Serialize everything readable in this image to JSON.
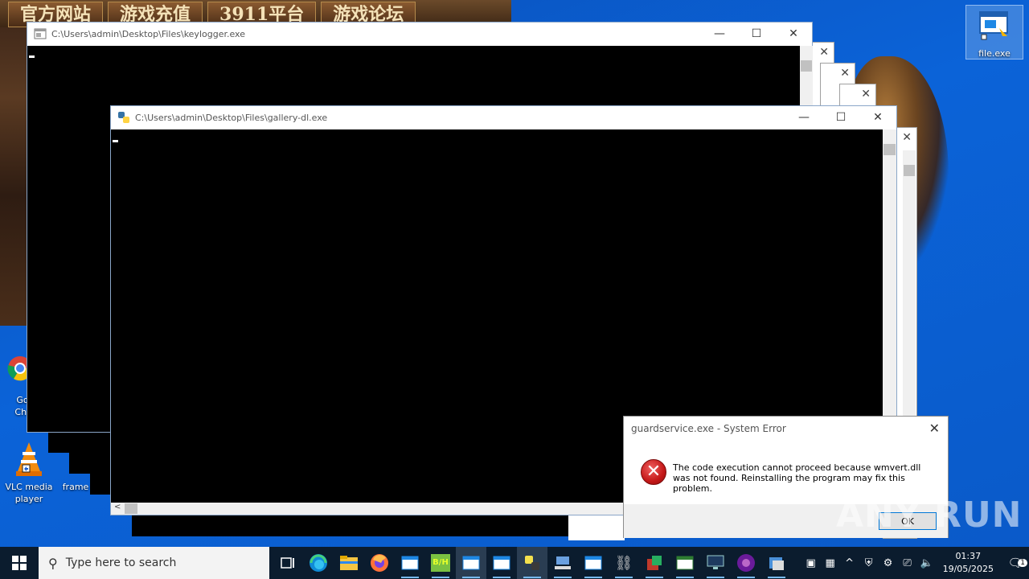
{
  "desktop": {
    "game_menu": [
      "官方网站",
      "游戏充值",
      "3911平台",
      "游戏论坛"
    ],
    "icons": [
      {
        "label": "Go\nChr",
        "kind": "chrome"
      },
      {
        "label": "VLC media player",
        "kind": "vlc"
      },
      {
        "label": "frame",
        "kind": "frame"
      },
      {
        "label": "file.exe",
        "kind": "file"
      }
    ]
  },
  "windows": {
    "keylogger": {
      "title": "C:\\Users\\admin\\Desktop\\Files\\keylogger.exe"
    },
    "gallery": {
      "title": "C:\\Users\\admin\\Desktop\\Files\\gallery-dl.exe"
    }
  },
  "dialog": {
    "title": "guardservice.exe - System Error",
    "message": "The code execution cannot proceed because wmvert.dll was not found. Reinstalling the program may fix this problem.",
    "ok_label": "OK"
  },
  "watermark": "ANY RUN",
  "taskbar": {
    "search_placeholder": "Type here to search",
    "time": "01:37",
    "date": "19/05/2025",
    "notification_count": "1",
    "bh_label": "B/H"
  },
  "colors": {
    "taskbar": "#0b1c2e",
    "desktop": "#0a5fc8",
    "error_red": "#c41818",
    "accent": "#0078d7"
  }
}
